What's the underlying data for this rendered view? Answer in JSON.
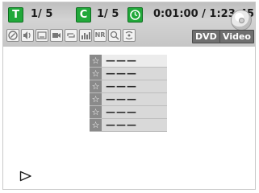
{
  "status": {
    "title_badge": "T",
    "title_counter": "1/ 5",
    "chapter_badge": "C",
    "chapter_counter": "1/ 5",
    "time": "0:01:00 / 1:23:45",
    "mode_dvd": "DVD",
    "mode_video": "Video"
  },
  "icons": [
    "audio-settings-icon",
    "sound-icon",
    "subtitle-icon",
    "camera-angle-icon",
    "repeat-icon",
    "equalizer-icon",
    "nr-icon",
    "zoom-icon",
    "surround-icon"
  ],
  "icon_labels": {
    "nr": "NR"
  },
  "marker_list": {
    "items": [
      {
        "star": "☆",
        "value": "———",
        "selected": true
      },
      {
        "star": "☆",
        "value": "———",
        "selected": false
      },
      {
        "star": "☆",
        "value": "———",
        "selected": false
      },
      {
        "star": "☆",
        "value": "———",
        "selected": false
      },
      {
        "star": "☆",
        "value": "———",
        "selected": false
      },
      {
        "star": "☆",
        "value": "———",
        "selected": false
      }
    ]
  },
  "playback": {
    "state_icon": "play-icon"
  }
}
